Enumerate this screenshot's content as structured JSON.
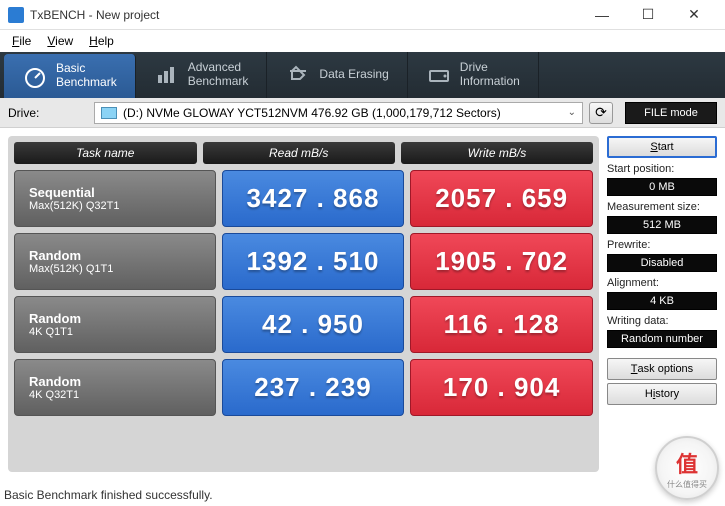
{
  "window": {
    "title": "TxBENCH - New project"
  },
  "menu": {
    "file": "File",
    "view": "View",
    "help": "Help"
  },
  "tabs": {
    "basic": "Basic\nBenchmark",
    "advanced": "Advanced\nBenchmark",
    "erasing": "Data Erasing",
    "drive_info": "Drive\nInformation"
  },
  "drive": {
    "label": "Drive:",
    "selected": "(D:) NVMe GLOWAY YCT512NVM  476.92 GB (1,000,179,712 Sectors)"
  },
  "file_mode": "FILE mode",
  "headers": {
    "task": "Task name",
    "read": "Read mB/s",
    "write": "Write mB/s"
  },
  "rows": [
    {
      "name": "Sequential",
      "sub": "Max(512K) Q32T1",
      "read": "3427.868",
      "write": "2057.659"
    },
    {
      "name": "Random",
      "sub": "Max(512K) Q1T1",
      "read": "1392.510",
      "write": "1905.702"
    },
    {
      "name": "Random",
      "sub": "4K Q1T1",
      "read": "42.950",
      "write": "116.128"
    },
    {
      "name": "Random",
      "sub": "4K Q32T1",
      "read": "237.239",
      "write": "170.904"
    }
  ],
  "side": {
    "start": "Start",
    "start_pos_label": "Start position:",
    "start_pos": "0 MB",
    "meas_size_label": "Measurement size:",
    "meas_size": "512 MB",
    "prewrite_label": "Prewrite:",
    "prewrite": "Disabled",
    "alignment_label": "Alignment:",
    "alignment": "4 KB",
    "writing_label": "Writing data:",
    "writing": "Random number",
    "task_options": "Task options",
    "history": "History"
  },
  "status": "Basic Benchmark finished successfully.",
  "watermark": {
    "main": "值",
    "sub": "什么值得买"
  },
  "chart_data": {
    "type": "table",
    "title": "TxBENCH Basic Benchmark",
    "columns": [
      "Task name",
      "Read mB/s",
      "Write mB/s"
    ],
    "rows": [
      [
        "Sequential Max(512K) Q32T1",
        3427.868,
        2057.659
      ],
      [
        "Random Max(512K) Q1T1",
        1392.51,
        1905.702
      ],
      [
        "Random 4K Q1T1",
        42.95,
        116.128
      ],
      [
        "Random 4K Q32T1",
        237.239,
        170.904
      ]
    ]
  }
}
